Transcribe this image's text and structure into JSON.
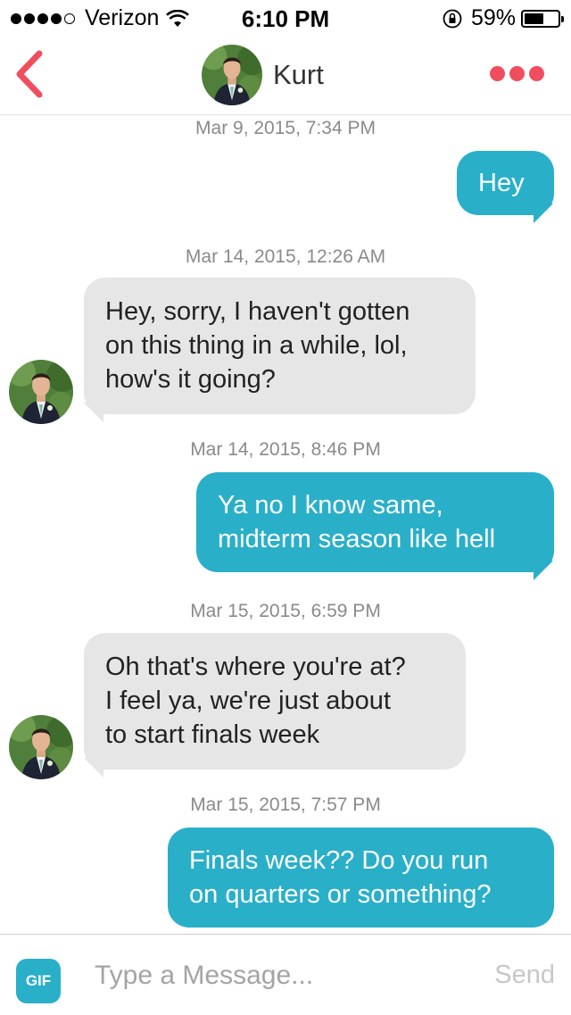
{
  "status_bar": {
    "carrier": "Verizon",
    "time": "6:10 PM",
    "battery_percent": "59%",
    "battery_level": 0.59,
    "signal_bars": 4,
    "signal_max": 5
  },
  "header": {
    "contact_name": "Kurt",
    "back_icon": "chevron-left-icon",
    "more_icon": "more-dots-icon",
    "accent_color": "#f04e5e"
  },
  "messages": [
    {
      "timestamp": "Mar 9, 2015, 7:34 PM",
      "direction": "outgoing",
      "lines": [
        "Hey"
      ]
    },
    {
      "timestamp": "Mar 14, 2015, 12:26 AM",
      "direction": "incoming",
      "lines": [
        "Hey, sorry, I haven't gotten",
        "on this thing in a while, lol,",
        "how's it going?"
      ]
    },
    {
      "timestamp": "Mar 14, 2015, 8:46 PM",
      "direction": "outgoing",
      "lines": [
        "Ya no I know same,",
        "midterm season like hell"
      ]
    },
    {
      "timestamp": "Mar 15, 2015, 6:59 PM",
      "direction": "incoming",
      "lines": [
        "Oh that's where you're at?",
        "I feel ya, we're just about",
        "to start finals week"
      ]
    },
    {
      "timestamp": "Mar 15, 2015, 7:57 PM",
      "direction": "outgoing",
      "lines": [
        "Finals week?? Do you run",
        "on quarters or something?"
      ]
    }
  ],
  "composer": {
    "gif_label": "GIF",
    "placeholder": "Type a Message...",
    "send_label": "Send"
  },
  "colors": {
    "outgoing_bubble": "#2aafc9",
    "incoming_bubble": "#e6e6e6",
    "timestamp": "#8a8a8a"
  }
}
